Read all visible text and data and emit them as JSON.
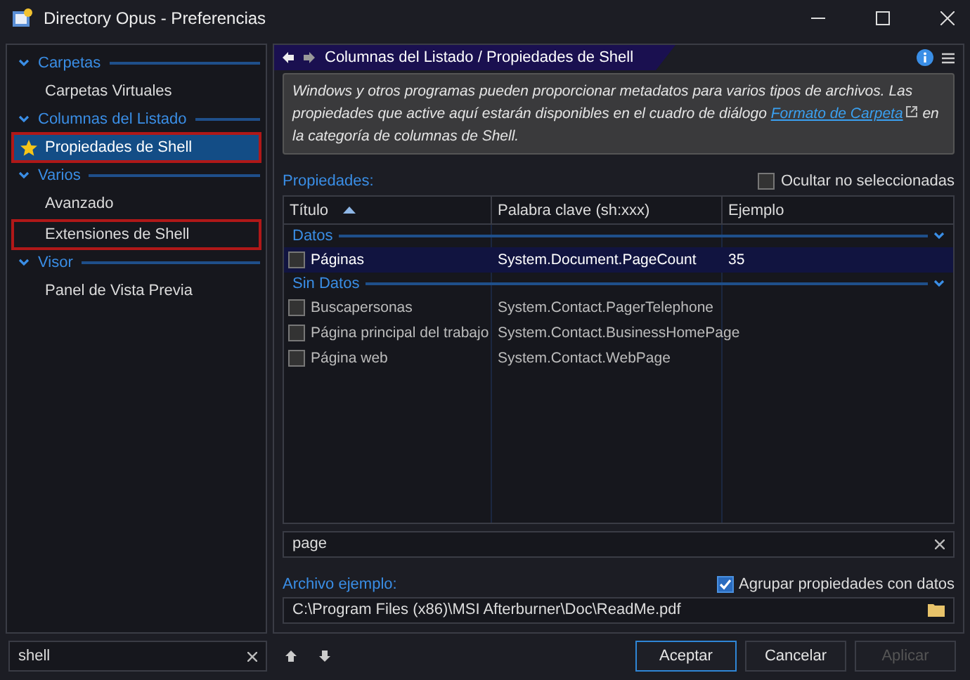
{
  "window": {
    "title": "Directory Opus - Preferencias"
  },
  "sidebar": {
    "groups": [
      {
        "label": "Carpetas",
        "expanded": true,
        "items": [
          {
            "label": "Carpetas Virtuales",
            "selected": false,
            "highlighted": false,
            "starred": false
          }
        ]
      },
      {
        "label": "Columnas del Listado",
        "expanded": true,
        "items": [
          {
            "label": "Propiedades de Shell",
            "selected": true,
            "highlighted": true,
            "starred": true
          }
        ]
      },
      {
        "label": "Varios",
        "expanded": true,
        "items": [
          {
            "label": "Avanzado",
            "selected": false,
            "highlighted": false,
            "starred": false
          },
          {
            "label": "Extensiones de Shell",
            "selected": false,
            "highlighted": true,
            "starred": false
          }
        ]
      },
      {
        "label": "Visor",
        "expanded": true,
        "items": [
          {
            "label": "Panel de Vista Previa",
            "selected": false,
            "highlighted": false,
            "starred": false
          }
        ]
      }
    ],
    "search": {
      "value": "shell"
    }
  },
  "breadcrumb": "Columnas del Listado / Propiedades de Shell",
  "description": {
    "before": "Windows y otros programas pueden proporcionar metadatos para varios tipos de archivos. Las propiedades que active aquí estarán disponibles en el cuadro de diálogo",
    "link": "Formato de Carpeta",
    "after": "en la categoría de columnas de Shell."
  },
  "properties": {
    "label": "Propiedades:",
    "hide_unselected": {
      "label": "Ocultar no seleccionadas",
      "checked": false
    },
    "columns": [
      "Título",
      "Palabra clave (sh:xxx)",
      "Ejemplo"
    ],
    "groups": [
      {
        "label": "Datos",
        "expanded": true,
        "rows": [
          {
            "checked": false,
            "selected": true,
            "cells": [
              "Páginas",
              "System.Document.PageCount",
              "35"
            ]
          }
        ]
      },
      {
        "label": "Sin Datos",
        "expanded": true,
        "rows": [
          {
            "checked": false,
            "selected": false,
            "cells": [
              "Buscapersonas",
              "System.Contact.PagerTelephone"
            ]
          },
          {
            "checked": false,
            "selected": false,
            "cells": [
              "Página principal del trabajo",
              "System.Contact.BusinessHomePage"
            ]
          },
          {
            "checked": false,
            "selected": false,
            "cells": [
              "Página web",
              "System.Contact.WebPage"
            ]
          }
        ]
      }
    ],
    "filter": {
      "value": "page"
    }
  },
  "sample_file": {
    "label": "Archivo ejemplo:",
    "group_with_data": {
      "label": "Agrupar propiedades con datos",
      "checked": true
    },
    "path": "C:\\Program Files (x86)\\MSI Afterburner\\Doc\\ReadMe.pdf"
  },
  "buttons": [
    {
      "label": "Aceptar",
      "disabled": false,
      "default": true
    },
    {
      "label": "Cancelar",
      "disabled": false,
      "default": false
    },
    {
      "label": "Aplicar",
      "disabled": true,
      "default": false
    }
  ]
}
